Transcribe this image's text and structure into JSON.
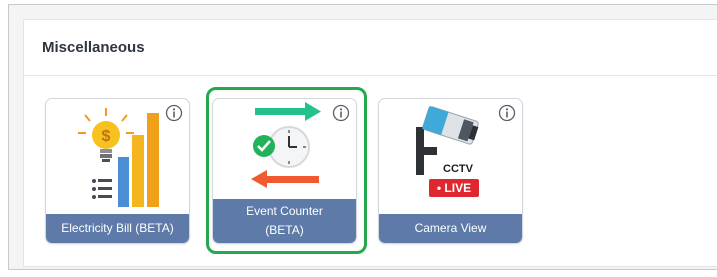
{
  "section": {
    "title": "Miscellaneous"
  },
  "tiles": [
    {
      "label": "Electricity Bill (BETA)",
      "icon": "electricity-bill-icon",
      "info_icon": "info-icon"
    },
    {
      "label": "Event Counter\n(BETA)",
      "icon": "event-counter-icon",
      "info_icon": "info-icon",
      "selected": true
    },
    {
      "label": "Camera View",
      "icon": "cctv-camera-icon",
      "info_icon": "info-icon"
    }
  ],
  "camera_art": {
    "cctv": "CCTV",
    "live": "• LIVE"
  },
  "colors": {
    "tile_label_bg": "#5d7aa9",
    "highlight_border": "#23a94c",
    "live_red": "#e0262f"
  }
}
